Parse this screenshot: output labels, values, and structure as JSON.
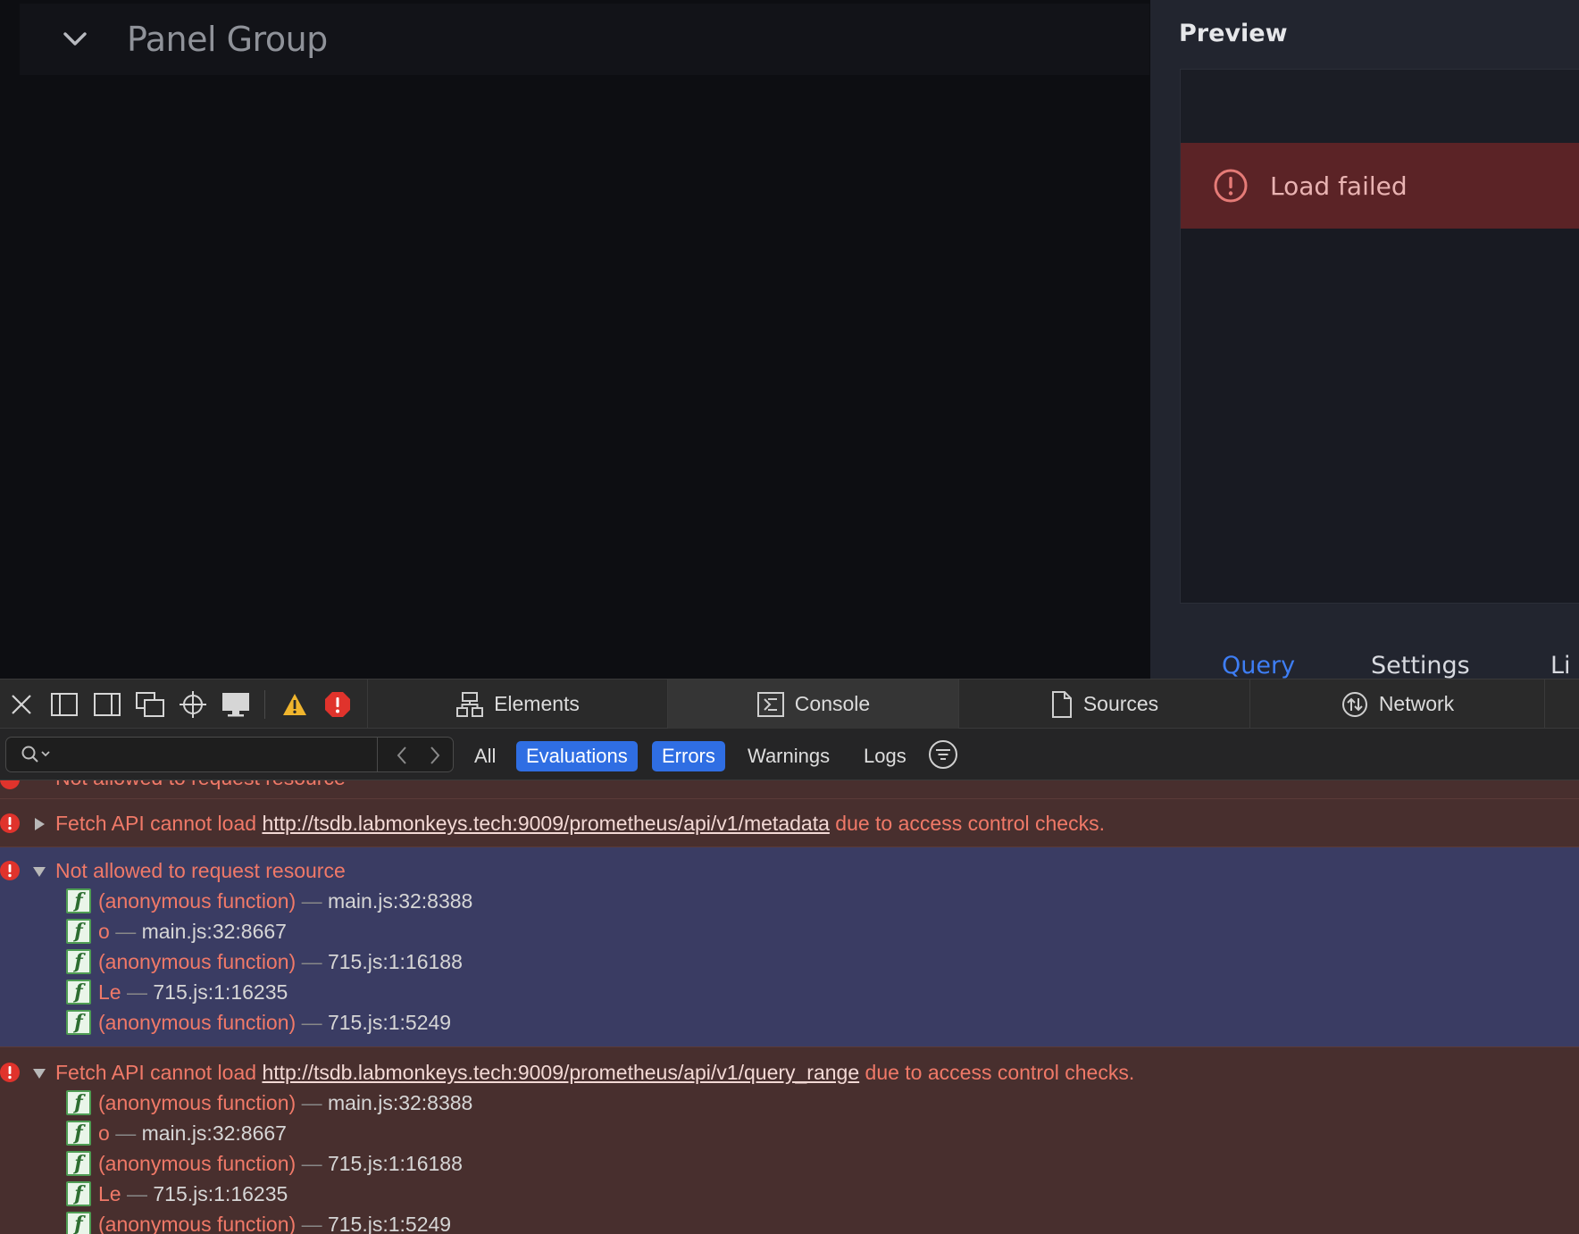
{
  "app": {
    "panel_group_title": "Panel Group",
    "preview": {
      "title": "Preview",
      "alert": "Load failed",
      "tabs": [
        "Query",
        "Settings",
        "Li"
      ]
    }
  },
  "devtools": {
    "tabs": [
      {
        "label": "Elements",
        "icon": "elements-icon"
      },
      {
        "label": "Console",
        "icon": "console-icon"
      },
      {
        "label": "Sources",
        "icon": "sources-icon"
      },
      {
        "label": "Network",
        "icon": "network-icon"
      }
    ],
    "search": {
      "placeholder": "",
      "value": ""
    },
    "filters": [
      {
        "label": "All",
        "active": false
      },
      {
        "label": "Evaluations",
        "active": true
      },
      {
        "label": "Errors",
        "active": true
      },
      {
        "label": "Warnings",
        "active": false
      },
      {
        "label": "Logs",
        "active": false
      }
    ],
    "colors": {
      "accent": "#2f6ee3",
      "error_text": "#f07968",
      "error_bg": "#482f2e",
      "selected_bg": "#3a3c63"
    }
  },
  "console": {
    "messages": [
      {
        "pre": "Fetch API cannot load ",
        "url": "http://tsdb.labmonkeys.tech:9009/prometheus/api/v1/metadata",
        "post": " due to access control checks."
      },
      {
        "text": "Not allowed to request resource",
        "frames": [
          {
            "fn": "(anonymous function)",
            "loc": "main.js:32:8388"
          },
          {
            "fn": "o",
            "loc": "main.js:32:8667"
          },
          {
            "fn": "(anonymous function)",
            "loc": "715.js:1:16188"
          },
          {
            "fn": "Le",
            "loc": "715.js:1:16235"
          },
          {
            "fn": "(anonymous function)",
            "loc": "715.js:1:5249"
          }
        ]
      },
      {
        "pre": "Fetch API cannot load ",
        "url": "http://tsdb.labmonkeys.tech:9009/prometheus/api/v1/query_range",
        "post": " due to access control checks.",
        "frames": [
          {
            "fn": "(anonymous function)",
            "loc": "main.js:32:8388"
          },
          {
            "fn": "o",
            "loc": "main.js:32:8667"
          },
          {
            "fn": "(anonymous function)",
            "loc": "715.js:1:16188"
          },
          {
            "fn": "Le",
            "loc": "715.js:1:16235"
          },
          {
            "fn": "(anonymous function)",
            "loc": "715.js:1:5249"
          }
        ]
      }
    ],
    "dash": "—"
  }
}
